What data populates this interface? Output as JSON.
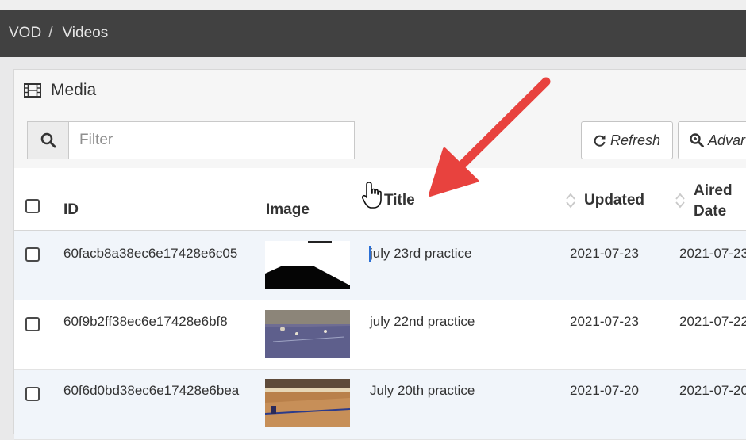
{
  "breadcrumb": {
    "root": "VOD",
    "separator": "/",
    "current": "Videos"
  },
  "panel": {
    "title": "Media",
    "icon": "film-icon"
  },
  "toolbar": {
    "filter_placeholder": "Filter",
    "filter_value": "",
    "refresh_label": "Refresh",
    "advanced_label": "Advar"
  },
  "table": {
    "columns": {
      "id": "ID",
      "image": "Image",
      "title": "Title",
      "updated": "Updated",
      "aired_line1": "Aired",
      "aired_line2": "Date"
    },
    "rows": [
      {
        "id": "60facb8a38ec6e17428e6c05",
        "title": "july 23rd practice",
        "updated": "2021-07-23",
        "aired": "2021-07-23"
      },
      {
        "id": "60f9b2ff38ec6e17428e6bf8",
        "title": "july 22nd practice",
        "updated": "2021-07-23",
        "aired": "2021-07-22"
      },
      {
        "id": "60f6d0bd38ec6e17428e6bea",
        "title": "July 20th practice",
        "updated": "2021-07-20",
        "aired": "2021-07-20"
      }
    ]
  },
  "colors": {
    "header_bar": "#414141",
    "arrow": "#e8423e",
    "row_alt": "#f1f5fa"
  }
}
